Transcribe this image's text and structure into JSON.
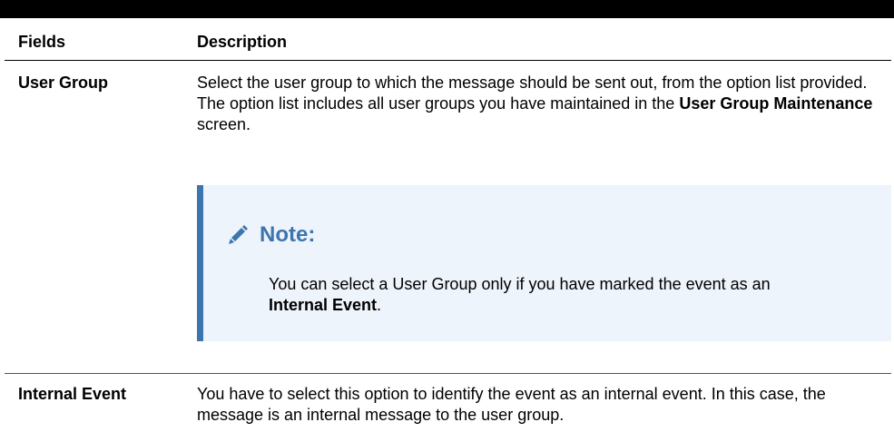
{
  "table": {
    "headers": {
      "fields": "Fields",
      "description": "Description"
    },
    "rows": [
      {
        "field": "User Group",
        "desc_part1": "Select the user group to which the message should be sent out, from the option list provided. The option list includes all user groups you have maintained in the ",
        "desc_bold": "User Group Maintenance",
        "desc_part2": " screen."
      },
      {
        "field": "Internal Event",
        "desc": "You have to select this option to identify the event as an internal event. In this case, the message is an internal message to the user group."
      }
    ]
  },
  "note": {
    "title": "Note:",
    "body_part1": "You can select a User Group only if you have marked the event as an ",
    "body_bold": "Internal Event",
    "body_part2": ".",
    "icon": "pencil-icon",
    "accent_color": "#3d75ad",
    "background_color": "#eef4fb"
  }
}
